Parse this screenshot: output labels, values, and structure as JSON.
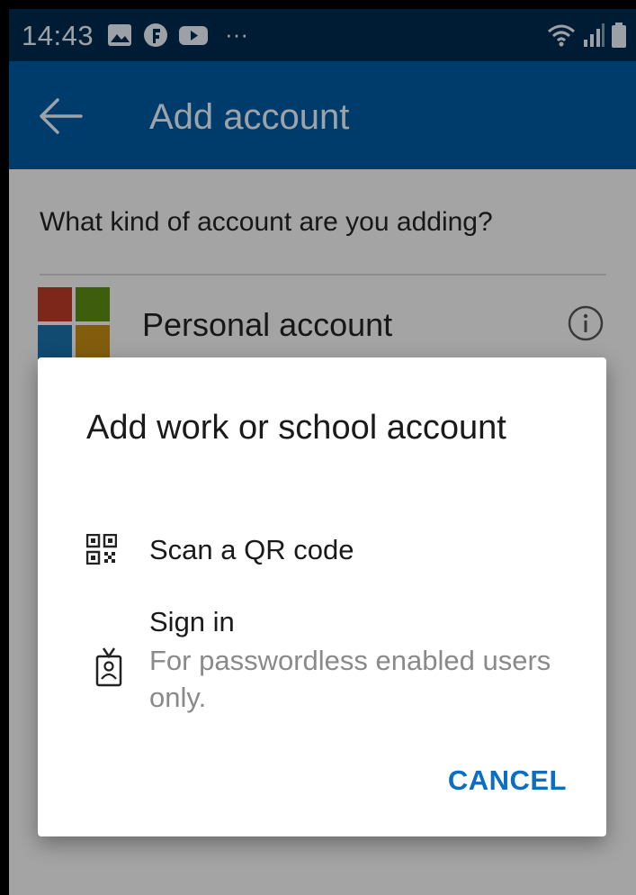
{
  "status_bar": {
    "time": "14:43",
    "icons_left": [
      "image-icon",
      "g-icon",
      "youtube-icon",
      "more-dots-icon"
    ],
    "icons_right": [
      "wifi-icon",
      "signal-icon",
      "battery-icon"
    ],
    "more_dots": "···"
  },
  "app_bar": {
    "title": "Add account"
  },
  "page": {
    "question": "What kind of account are you adding?",
    "personal_account_label": "Personal account",
    "logo_colors": [
      "#b73a26",
      "#5c8a14",
      "#1a6fa8",
      "#c08a14"
    ]
  },
  "dialog": {
    "title": "Add work or school account",
    "options": [
      {
        "label": "Scan a QR code",
        "icon": "qr-code-icon"
      },
      {
        "label": "Sign in",
        "sublabel": "For passwordless enabled users only.",
        "icon": "id-badge-icon"
      }
    ],
    "cancel_label": "CANCEL"
  },
  "colors": {
    "status_bar": "#002a4e",
    "app_bar": "#00599e",
    "accent": "#0a6fc2"
  }
}
